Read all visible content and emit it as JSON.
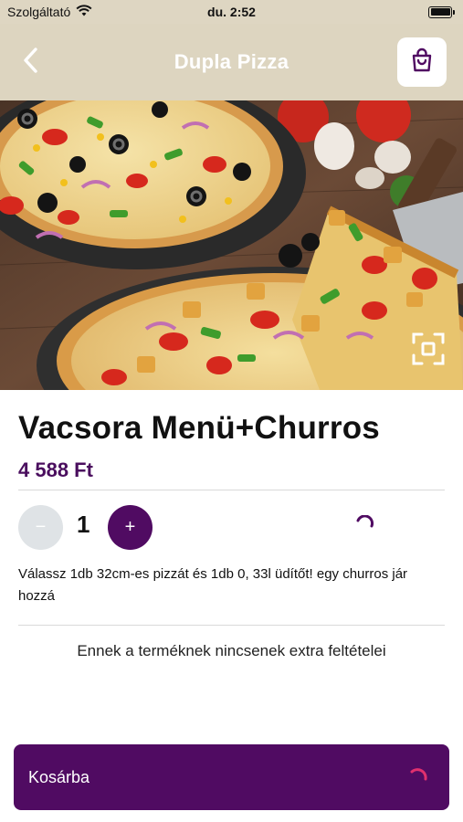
{
  "status_bar": {
    "carrier": "Szolgáltató",
    "time": "du. 2:52",
    "icons": [
      "wifi-icon",
      "battery-icon"
    ]
  },
  "nav": {
    "title": "Dupla Pizza",
    "back_icon": "chevron-left-icon",
    "cart_icon": "shopping-bag-icon"
  },
  "hero": {
    "image": "pizza-photo",
    "expand_icon": "fullscreen-expand-icon"
  },
  "product": {
    "name": "Vacsora Menü+Churros",
    "price": "4 588 Ft",
    "description": "Válassz 1db 32cm-es pizzát és 1db 0, 33l üdítőt! egy churros jár hozzá"
  },
  "quantity": {
    "minus_label": "−",
    "value": "1",
    "plus_label": "+"
  },
  "extras": {
    "message": "Ennek a terméknek nincsenek extra feltételei"
  },
  "footer": {
    "add_to_cart_label": "Kosárba"
  },
  "colors": {
    "accent": "#500b62",
    "header_bg": "#ddd5c0",
    "price": "#4a0e5e",
    "spinner": "#e0306e"
  }
}
